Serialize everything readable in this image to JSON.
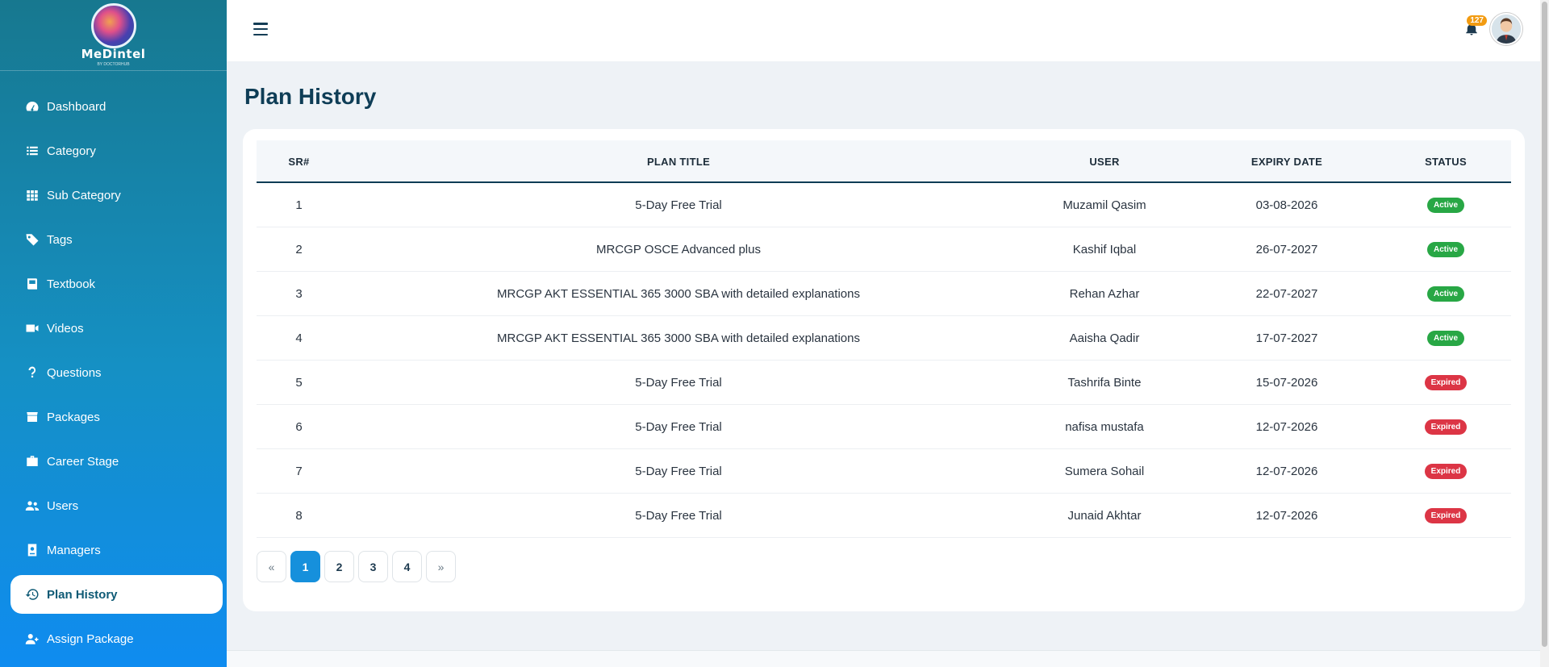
{
  "brand": {
    "name": "MeDintel",
    "tagline": "BY DOCTORHUB"
  },
  "sidebar": {
    "items": [
      {
        "label": "Dashboard",
        "icon": "dashboard-icon"
      },
      {
        "label": "Category",
        "icon": "list-icon"
      },
      {
        "label": "Sub Category",
        "icon": "grid-icon"
      },
      {
        "label": "Tags",
        "icon": "tag-icon"
      },
      {
        "label": "Textbook",
        "icon": "book-icon"
      },
      {
        "label": "Videos",
        "icon": "video-icon"
      },
      {
        "label": "Questions",
        "icon": "question-icon"
      },
      {
        "label": "Packages",
        "icon": "box-icon"
      },
      {
        "label": "Career Stage",
        "icon": "briefcase-icon"
      },
      {
        "label": "Users",
        "icon": "users-icon"
      },
      {
        "label": "Managers",
        "icon": "id-badge-icon"
      },
      {
        "label": "Plan History",
        "icon": "history-icon",
        "active": true
      },
      {
        "label": "Assign Package",
        "icon": "user-plus-icon"
      }
    ]
  },
  "header": {
    "notification_count": "127"
  },
  "page": {
    "title": "Plan History"
  },
  "table": {
    "columns": [
      "SR#",
      "PLAN TITLE",
      "USER",
      "EXPIRY DATE",
      "STATUS"
    ],
    "rows": [
      {
        "sr": "1",
        "plan": "5-Day Free Trial",
        "user": "Muzamil Qasim",
        "expiry": "03-08-2026",
        "status": "Active"
      },
      {
        "sr": "2",
        "plan": "MRCGP OSCE Advanced plus",
        "user": "Kashif Iqbal",
        "expiry": "26-07-2027",
        "status": "Active"
      },
      {
        "sr": "3",
        "plan": "MRCGP AKT ESSENTIAL 365 3000 SBA with detailed explanations",
        "user": "Rehan Azhar",
        "expiry": "22-07-2027",
        "status": "Active"
      },
      {
        "sr": "4",
        "plan": "MRCGP AKT ESSENTIAL 365 3000 SBA with detailed explanations",
        "user": "Aaisha Qadir",
        "expiry": "17-07-2027",
        "status": "Active"
      },
      {
        "sr": "5",
        "plan": "5-Day Free Trial",
        "user": "Tashrifa Binte",
        "expiry": "15-07-2026",
        "status": "Expired"
      },
      {
        "sr": "6",
        "plan": "5-Day Free Trial",
        "user": "nafisa mustafa",
        "expiry": "12-07-2026",
        "status": "Expired"
      },
      {
        "sr": "7",
        "plan": "5-Day Free Trial",
        "user": "Sumera Sohail",
        "expiry": "12-07-2026",
        "status": "Expired"
      },
      {
        "sr": "8",
        "plan": "5-Day Free Trial",
        "user": "Junaid Akhtar",
        "expiry": "12-07-2026",
        "status": "Expired"
      }
    ]
  },
  "pagination": {
    "prev": "«",
    "pages": [
      "1",
      "2",
      "3",
      "4"
    ],
    "current": "1",
    "next": "»"
  },
  "colors": {
    "sidebar_top": "#17788f",
    "sidebar_bottom": "#0f8cf0",
    "active_status": "#28a745",
    "expired_status": "#dc3545",
    "accent": "#1690dc"
  }
}
